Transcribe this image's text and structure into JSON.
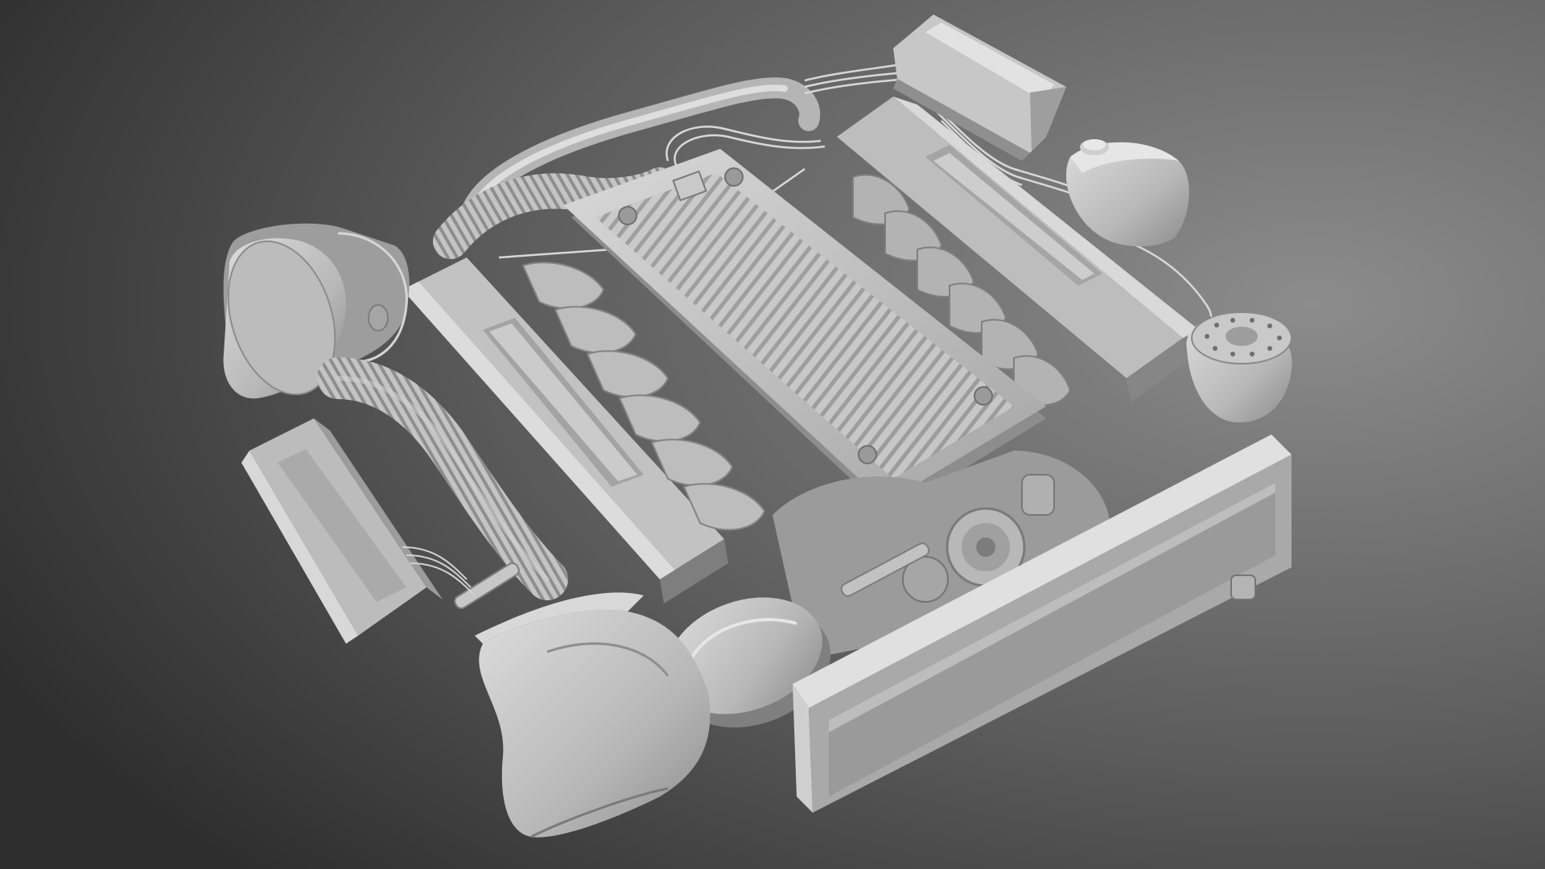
{
  "scene": {
    "subject": "",
    "colors": {
      "background_dark": "#2f2f2f",
      "background_light": "#8a8a8a",
      "metal_light": "#d6d6d6",
      "metal_mid": "#a9a9a9",
      "metal_dark": "#6e6e6e",
      "shadow": "#4a4a4a",
      "wire": "#e0e0e0"
    },
    "icons": {
      "engine": "engine-render"
    }
  }
}
